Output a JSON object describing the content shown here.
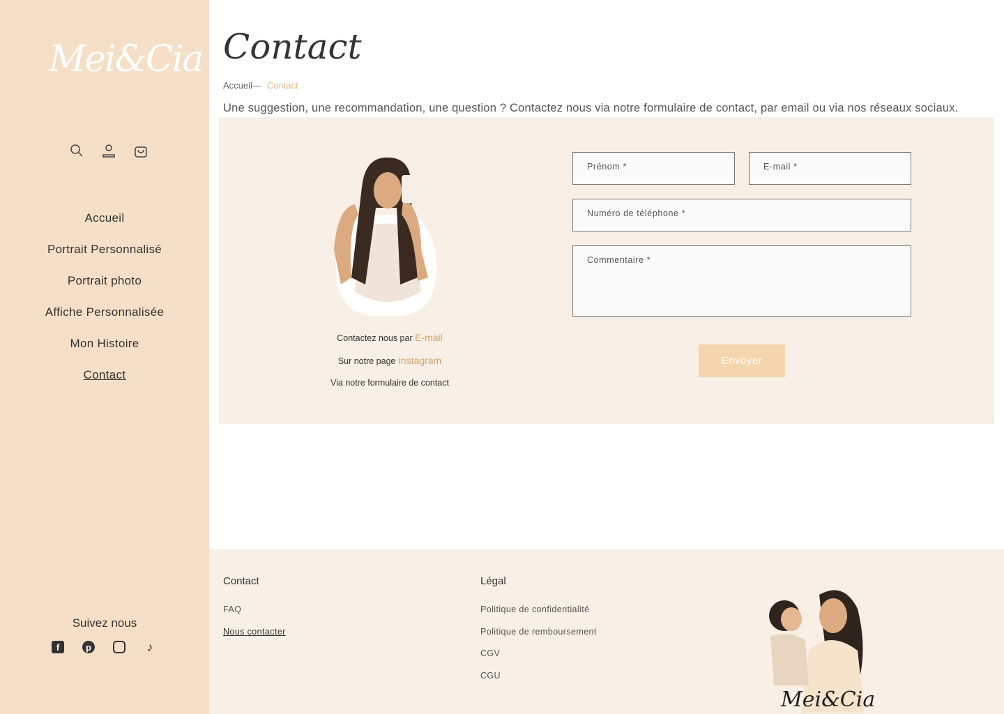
{
  "brand": {
    "logo_text": "Mei&Cia"
  },
  "sidebar": {
    "nav": [
      "Accueil",
      "Portrait Personnalisé",
      "Portrait photo",
      "Affiche Personnalisée",
      "Mon Histoire",
      "Contact"
    ],
    "active": "Contact",
    "follow": "Suivez nous",
    "social": [
      "facebook-icon",
      "pinterest-icon",
      "instagram-icon",
      "tiktok-icon"
    ]
  },
  "page": {
    "title": "Contact",
    "breadcrumb": [
      "Accueil",
      "Contact"
    ],
    "intro": "Une suggestion, une recommandation, une question ? Contactez nous via notre formulaire de contact, par email ou via nos réseaux sociaux."
  },
  "contact_info": {
    "line1": "Contactez nous par",
    "line1_link": "E-mail",
    "line2": "Sur notre page",
    "line2_link": "Instagram",
    "line3": "Via notre formulaire de contact"
  },
  "form": {
    "first_name": "Prénom *",
    "email": "E-mail *",
    "phone": "Numéro de téléphone *",
    "comment": "Commentaire *",
    "submit": "Envoyer"
  },
  "footer": {
    "contact_heading": "Contact",
    "contact_links": [
      "FAQ",
      "Nous contacter"
    ],
    "legal_heading": "Légal",
    "legal_links": [
      "Politique de confidentialité",
      "Politique de remboursement",
      "CGV",
      "CGU"
    ]
  },
  "colors": {
    "sidebar": "#f5dfc6",
    "panel": "#f8efe6",
    "accent": "#d4a46d",
    "button": "#f4d5ae"
  }
}
